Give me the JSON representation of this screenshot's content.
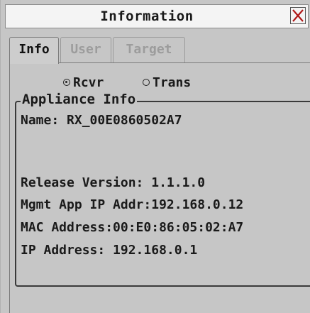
{
  "window": {
    "title": "Information"
  },
  "tabs": [
    {
      "label": "Info",
      "active": true
    },
    {
      "label": "User",
      "active": false
    },
    {
      "label": "Target",
      "active": false
    }
  ],
  "mode": {
    "options": [
      {
        "label": "Rcvr",
        "selected": true
      },
      {
        "label": "Trans",
        "selected": false
      }
    ]
  },
  "appliance_info": {
    "legend": "Appliance Info",
    "name_line": "Name: RX_00E0860502A7",
    "release_line": "Release Version: 1.1.1.0",
    "mgmt_ip_line": "Mgmt App IP Addr:192.168.0.12",
    "mac_line": "MAC Address:00:E0:86:05:02:A7",
    "ip_line": "IP Address: 192.168.0.1"
  },
  "icons": {
    "close": "close-icon"
  }
}
